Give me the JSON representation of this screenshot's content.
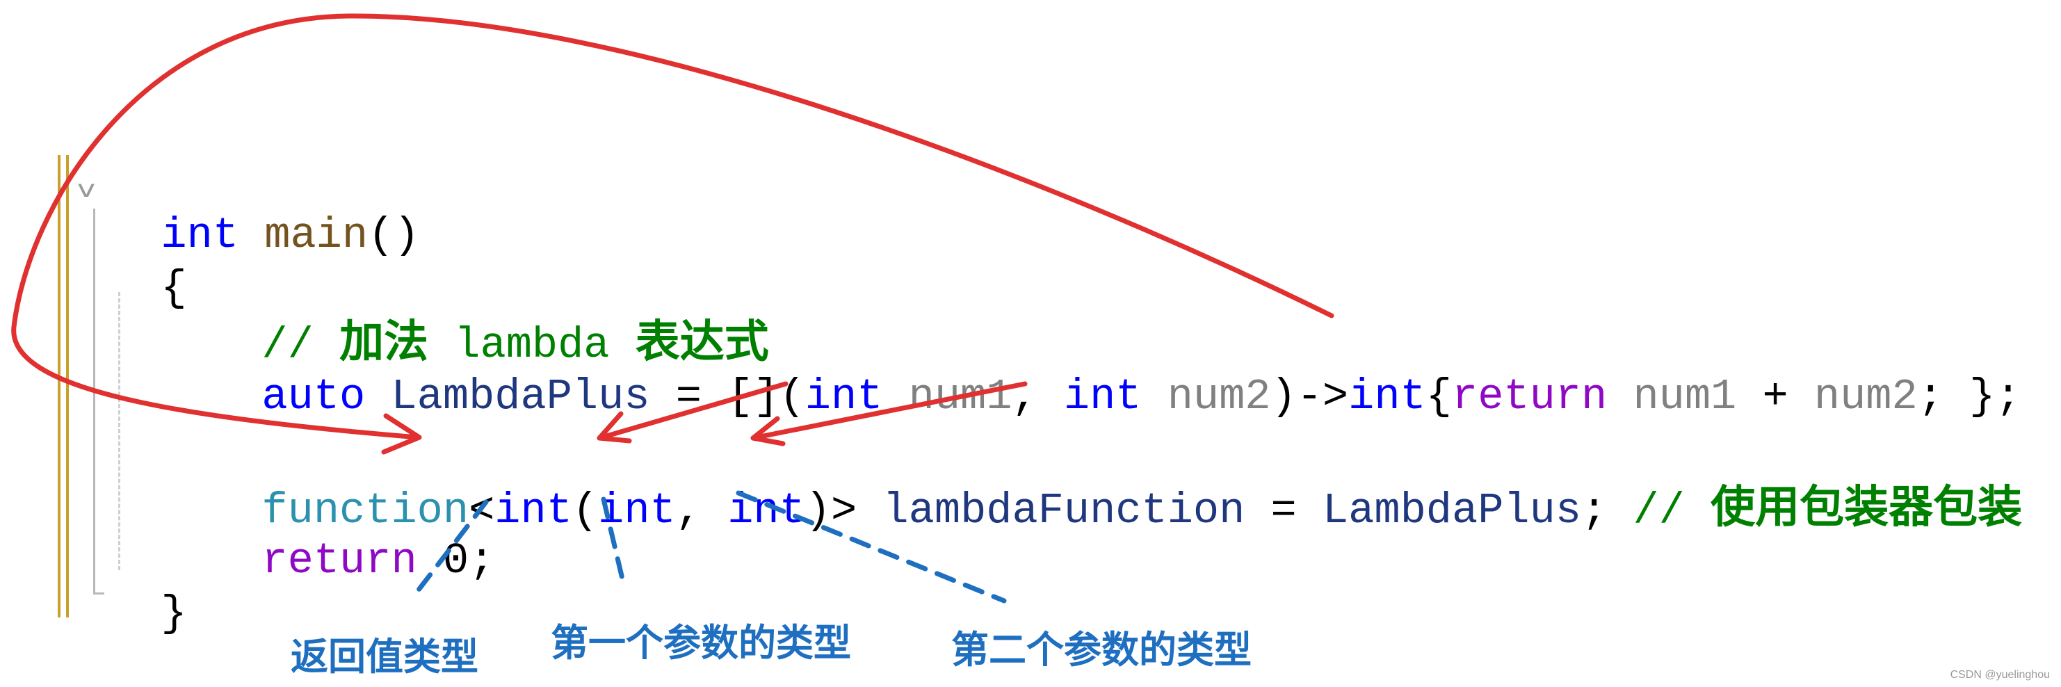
{
  "code": {
    "line1": {
      "kw_int": "int",
      "fn_main": "main",
      "parens": "()"
    },
    "line2": {
      "brace_open": "{"
    },
    "line3": {
      "slashes": "//",
      "cjk1": "加法",
      "word": "lambda",
      "cjk2": "表达式"
    },
    "line4": {
      "kw_auto": "auto",
      "var_name": "LambdaPlus",
      "assign": " = []",
      "open_paren": "(",
      "kw_int1": "int",
      "param1": " num1",
      "comma": ", ",
      "kw_int2": "int",
      "param2": " num2",
      "arrow": ")->",
      "kw_int3": "int",
      "brace": "{",
      "kw_return": "return",
      "param3": " num1",
      "plus": " + ",
      "param4": "num2",
      "tail": "; };"
    },
    "line5": {
      "type_function": "function",
      "lt": "<",
      "kw_int_ret": "int",
      "open_paren": "(",
      "kw_int_a": "int",
      "comma": ", ",
      "kw_int_b": "int",
      "close": ")>",
      "var_name": "lambdaFunction",
      "assign": " = ",
      "var_rhs": "LambdaPlus",
      "semi": ";",
      "slashes": "//",
      "comment_cjk": "使用包装器包装"
    },
    "line6": {
      "kw_return": "return",
      "value": " 0;"
    },
    "line7": {
      "brace_close": "}"
    }
  },
  "annotations": {
    "return_type_label": "返回值类型",
    "first_param_label": "第一个参数的类型",
    "second_param_label": "第二个参数的类型"
  },
  "colors": {
    "arrow_red": "#e03030",
    "annotation_blue": "#1f6fc0",
    "gutter_gold": "#c8a02a"
  },
  "icons": {
    "fold": "chevron-down-icon"
  },
  "watermark": "CSDN @yuelinghou"
}
